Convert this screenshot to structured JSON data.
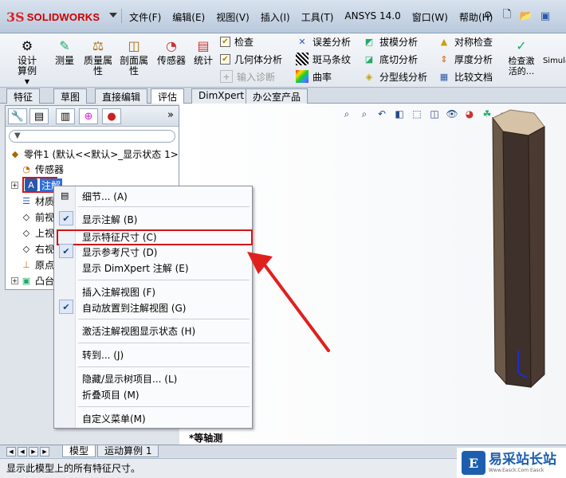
{
  "app": {
    "logo_prefix": "3S",
    "logo_name": "SOLIDWORKS"
  },
  "menubar": {
    "items": [
      {
        "id": "file",
        "label": "文件(F)"
      },
      {
        "id": "edit",
        "label": "编辑(E)"
      },
      {
        "id": "view",
        "label": "视图(V)"
      },
      {
        "id": "insert",
        "label": "插入(I)"
      },
      {
        "id": "tools",
        "label": "工具(T)"
      },
      {
        "id": "ansys",
        "label": "ANSYS 14.0"
      },
      {
        "id": "window",
        "label": "窗口(W)"
      },
      {
        "id": "help",
        "label": "帮助(H)"
      }
    ]
  },
  "ribbon": {
    "design_study": "设计算例",
    "measure": "测量",
    "mass_props": "质量属性",
    "section_props": "剖面属性",
    "sensor": "传感器",
    "statistics": "统计",
    "check": "检查",
    "geometry_analysis": "几何体分析",
    "import_diagnostics": "输入诊断",
    "deviation_analysis": "误差分析",
    "zebra_stripes": "斑马条纹",
    "curvature": "曲率",
    "draft_analysis": "拔模分析",
    "undercut_analysis": "底切分析",
    "parting_line_analysis": "分型线分析",
    "symmetry_check": "对称检查",
    "thickness_analysis": "厚度分析",
    "compare_documents": "比较文档",
    "check_active": "检查激活的...",
    "simulation": "Simula"
  },
  "tabs": [
    {
      "id": "features",
      "label": "特征"
    },
    {
      "id": "sketch",
      "label": "草图"
    },
    {
      "id": "direct_edit",
      "label": "直接编辑"
    },
    {
      "id": "evaluate",
      "label": "评估"
    },
    {
      "id": "dimxpert",
      "label": "DimXpert"
    },
    {
      "id": "office",
      "label": "办公室产品"
    }
  ],
  "tree": {
    "root": "零件1 (默认<<默认>_显示状态 1>",
    "sensors": "传感器",
    "annotations": "注解",
    "material": "材质",
    "front": "前视",
    "top": "上视",
    "right": "右视",
    "origin": "原点",
    "boss": "凸台"
  },
  "context_menu": {
    "details": "细节... (A)",
    "show_annotations": "显示注解 (B)",
    "show_feature_dims": "显示特征尺寸 (C)",
    "show_ref_dims": "显示参考尺寸 (D)",
    "show_dimxpert": "显示 DimXpert 注解 (E)",
    "insert_annot_view": "插入注解视图 (F)",
    "auto_place": "自动放置到注解视图 (G)",
    "activate_display_state": "激活注解视图显示状态 (H)",
    "goto": "转到... (J)",
    "hide_show_tree": "隐藏/显示树项目... (L)",
    "collapse": "折叠项目 (M)",
    "customize": "自定义菜单(M)"
  },
  "viewport": {
    "view_label": "*等轴测"
  },
  "bottom_tabs": [
    {
      "id": "model",
      "label": "模型"
    },
    {
      "id": "motion",
      "label": "运动算例 1"
    }
  ],
  "status": {
    "text": "显示此模型上的所有特征尺寸。"
  },
  "watermark": {
    "logo": "E",
    "main": "易采站长站",
    "sub": "Www.Easck.Com Easck"
  },
  "colors": {
    "highlight_red": "#d0151b",
    "selection_blue": "#2f6fd6",
    "prism_dark": "#3e302a",
    "prism_top": "#d6c3a7"
  }
}
